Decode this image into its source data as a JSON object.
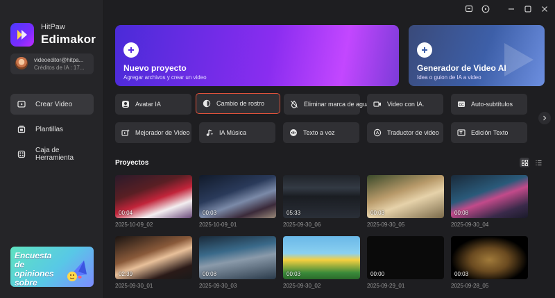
{
  "brand": {
    "small": "HitPaw",
    "big": "Edimakor"
  },
  "account": {
    "email": "videoeditor@hitpa...",
    "credits": "Créditos de IA : 17..."
  },
  "sidebar": {
    "items": [
      {
        "label": "Crear Video",
        "icon": "film-icon",
        "active": true
      },
      {
        "label": "Plantillas",
        "icon": "template-icon",
        "active": false
      },
      {
        "label": "Caja de Herramienta",
        "icon": "toolbox-icon",
        "active": false
      }
    ],
    "survey": "Encuesta de opiniones sobre"
  },
  "hero": {
    "new_project": {
      "title": "Nuevo proyecto",
      "subtitle": "Agregar archivos y crear un video"
    },
    "ai_video": {
      "title": "Generador de Video AI",
      "subtitle": "Idea o guion de IA a video"
    }
  },
  "tools": [
    {
      "label": "Avatar IA",
      "icon": "avatar-icon"
    },
    {
      "label": "Cambio de rostro",
      "icon": "face-swap-icon",
      "selected": true
    },
    {
      "label": "Eliminar marca de agua",
      "icon": "watermark-remove-icon"
    },
    {
      "label": "Video con IA.",
      "icon": "ai-video-icon"
    },
    {
      "label": "Auto-subtítulos",
      "icon": "subtitles-icon"
    },
    {
      "label": "Mejorador de Video",
      "icon": "enhance-icon"
    },
    {
      "label": "IA Música",
      "icon": "music-icon"
    },
    {
      "label": "Texto a voz",
      "icon": "tts-icon"
    },
    {
      "label": "Traductor de video",
      "icon": "translate-icon"
    },
    {
      "label": "Edición Texto",
      "icon": "text-edit-icon"
    }
  ],
  "projects": {
    "title": "Proyectos",
    "items": [
      {
        "duration": "00:04",
        "name": "2025-10-09_02"
      },
      {
        "duration": "00:03",
        "name": "2025-10-09_01"
      },
      {
        "duration": "05:33",
        "name": "2025-09-30_06"
      },
      {
        "duration": "00:03",
        "name": "2025-09-30_05"
      },
      {
        "duration": "00:08",
        "name": "2025-09-30_04"
      },
      {
        "duration": "02:39",
        "name": "2025-09-30_01"
      },
      {
        "duration": "00:08",
        "name": "2025-09-30_03"
      },
      {
        "duration": "00:03",
        "name": "2025-09-30_02"
      },
      {
        "duration": "00:00",
        "name": "2025-09-29_01"
      },
      {
        "duration": "00:03",
        "name": "2025-09-28_05"
      }
    ]
  },
  "colors": {
    "accent": "#e2523a",
    "sidebar": "#252528",
    "background": "#1e1e21"
  }
}
